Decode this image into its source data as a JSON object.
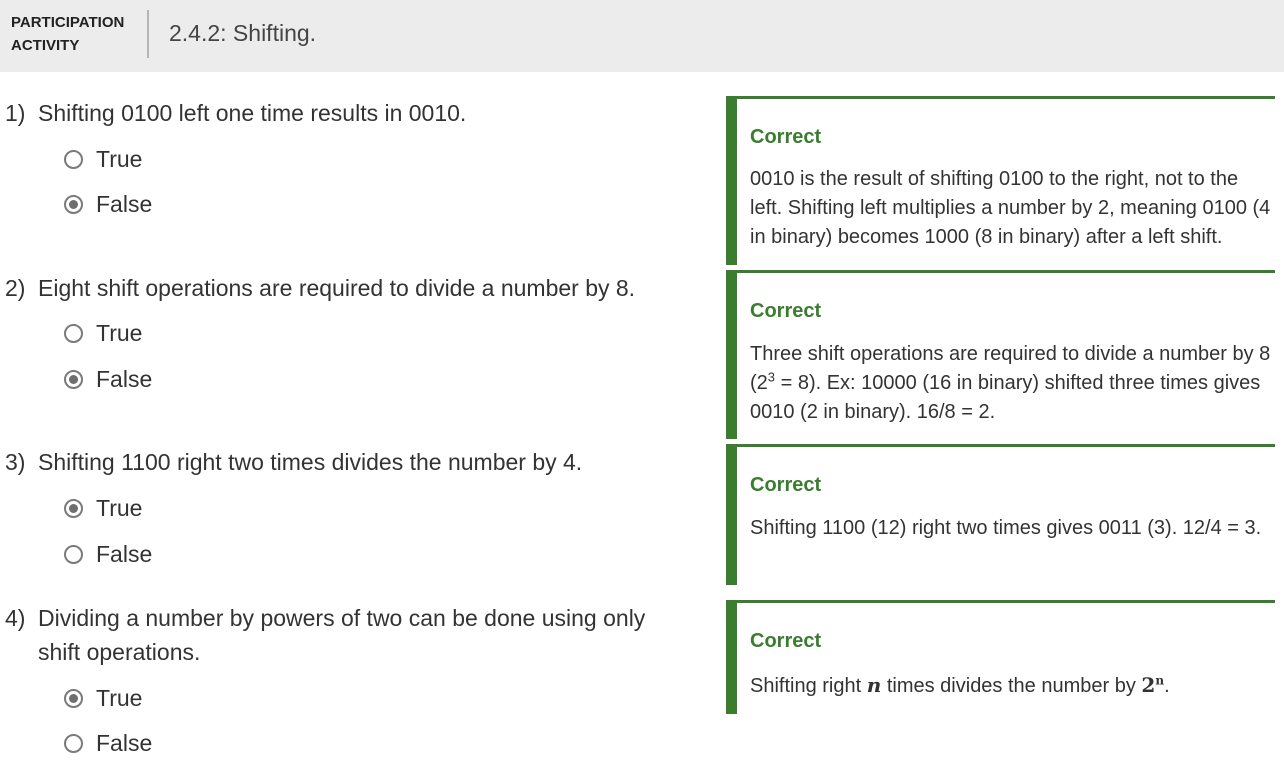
{
  "header": {
    "activity_label": "PARTICIPATION ACTIVITY",
    "title": "2.4.2: Shifting."
  },
  "questions": [
    {
      "number": "1)",
      "text": "Shifting 0100 left one time results in 0010.",
      "options": [
        {
          "label": "True",
          "selected": false
        },
        {
          "label": "False",
          "selected": true
        }
      ],
      "feedback": {
        "status": "Correct",
        "explanation": "0010 is the result of shifting 0100 to the right, not to the left. Shifting left multiplies a number by 2, meaning 0100 (4 in binary) becomes 1000 (8 in binary) after a left shift."
      }
    },
    {
      "number": "2)",
      "text": "Eight shift operations are required to divide a number by 8.",
      "options": [
        {
          "label": "True",
          "selected": false
        },
        {
          "label": "False",
          "selected": true
        }
      ],
      "feedback": {
        "status": "Correct",
        "explanation_part1": "Three shift operations are required to divide a number by 8 (2",
        "explanation_sup": "3",
        "explanation_part2": " = 8). Ex: 10000 (16 in binary) shifted three times gives 0010 (2 in binary). 16/8 = 2."
      }
    },
    {
      "number": "3)",
      "text": "Shifting 1100 right two times divides the number by 4.",
      "options": [
        {
          "label": "True",
          "selected": true
        },
        {
          "label": "False",
          "selected": false
        }
      ],
      "feedback": {
        "status": "Correct",
        "explanation": "Shifting 1100 (12) right two times gives 0011 (3). 12/4 = 3."
      }
    },
    {
      "number": "4)",
      "text": "Dividing a number by powers of two can be done using only shift operations.",
      "options": [
        {
          "label": "True",
          "selected": true
        },
        {
          "label": "False",
          "selected": false
        }
      ],
      "feedback": {
        "status": "Correct",
        "explanation_part1": "Shifting right ",
        "math_var": "n",
        "explanation_part2": " times divides the number by ",
        "math_base": "2",
        "math_exp": "n",
        "explanation_part3": "."
      }
    }
  ],
  "colors": {
    "header_bg": "#ececec",
    "correct_green": "#3a7d2f",
    "text": "#333333"
  }
}
